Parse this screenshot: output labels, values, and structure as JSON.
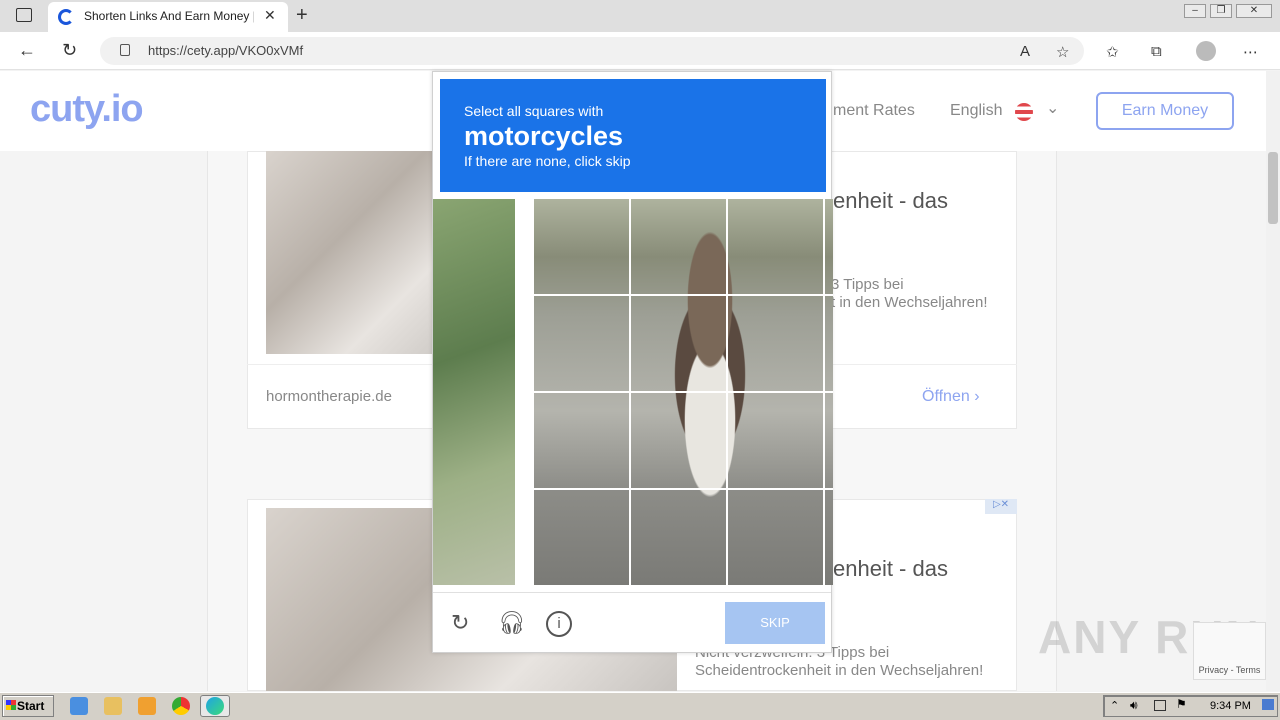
{
  "browser": {
    "tab_title": "Shorten Links And Earn Money | c",
    "url": "https://cety.app/VKO0xVMf"
  },
  "site": {
    "logo": "cuty.io",
    "nav_rates": "ment Rates",
    "nav_language": "English",
    "earn_button": "Earn Money"
  },
  "ads": {
    "card1_headline": "enheit - das",
    "card1_sub1": "3 Tipps bei",
    "card1_sub2": "t in den Wechseljahren!",
    "card1_domain": "hormontherapie.de",
    "card1_open": "Öffnen",
    "card2_headline": "enheit - das",
    "card2_sub1": "Nicht verzweifeln: 3 Tipps bei",
    "card2_sub2": "Scheidentrockenheit in den Wechseljahren!"
  },
  "captcha": {
    "instruction": "Select all squares with",
    "target": "motorcycles",
    "note": "If there are none, click skip",
    "skip_label": "SKIP"
  },
  "watermark": "ANY RUN",
  "recaptcha_footer": "Privacy - Terms",
  "taskbar": {
    "start_label": "Start",
    "clock": "9:34 PM"
  },
  "icons": [
    "tabs-icon",
    "new-tab-icon",
    "back-icon",
    "reload-icon",
    "lock-icon",
    "read-aloud-icon",
    "favorite-add-icon",
    "favorites-icon",
    "collections-icon",
    "profile-icon",
    "more-icon",
    "reload-challenge-icon",
    "audio-challenge-icon",
    "info-icon"
  ]
}
